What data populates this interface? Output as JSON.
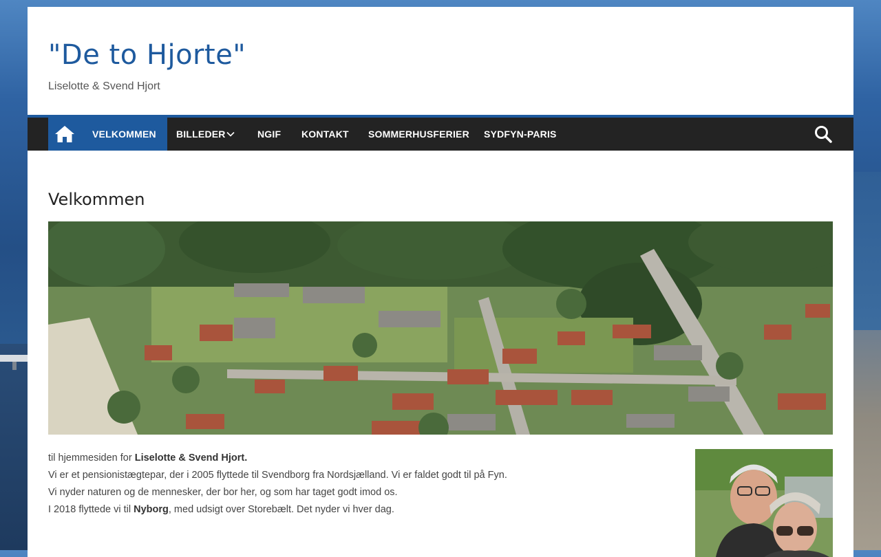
{
  "header": {
    "site_title": "\"De to Hjorte\"",
    "site_description": "Liselotte & Svend Hjort"
  },
  "nav": {
    "items": [
      {
        "label": "VELKOMMEN",
        "active": true
      },
      {
        "label": "BILLEDER",
        "has_dropdown": true
      },
      {
        "label": "NGIF"
      },
      {
        "label": "KONTAKT"
      },
      {
        "label": "SOMMERHUSFERIER"
      },
      {
        "label": "SYDFYN-PARIS"
      }
    ],
    "home_icon": "home-icon",
    "search_icon": "search-icon"
  },
  "main": {
    "title": "Velkommen",
    "paragraphs": [
      {
        "pre": "til hjemmesiden for ",
        "bold": "Liselotte & Svend Hjort.",
        "post": ""
      },
      {
        "text": "Vi er et pensionistægtepar, der i 2005 flyttede til Svendborg fra Nordsjælland. Vi er faldet godt til på Fyn."
      },
      {
        "text": "Vi nyder naturen og de mennesker, der bor her, og som har taget godt imod os."
      },
      {
        "pre": "I 2018 flyttede vi til ",
        "bold": "Nyborg",
        "post": ", med udsigt over Storebælt. Det nyder vi hver dag."
      }
    ]
  },
  "colors": {
    "accent": "#1e5a9e",
    "nav_bg": "#232323",
    "title": "#1e5a9e"
  }
}
